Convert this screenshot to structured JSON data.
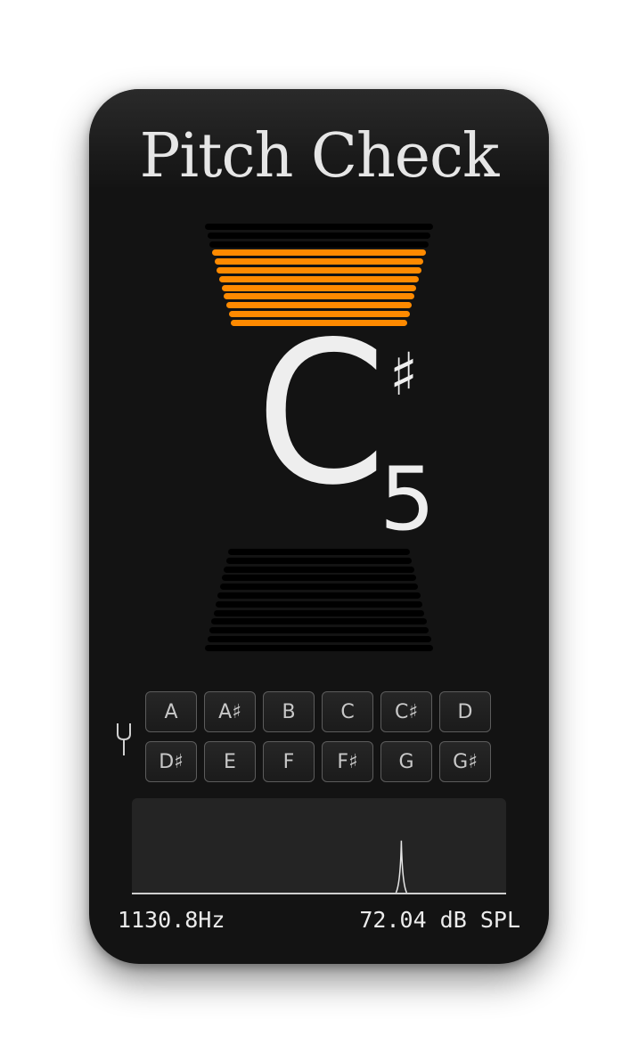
{
  "app": {
    "title": "Pitch Check"
  },
  "detected_note": {
    "letter": "C",
    "accidental": "♯",
    "octave": "5"
  },
  "tuning_meter": {
    "upper_bars_total": 12,
    "upper_bars_lit": 9,
    "lower_bars_total": 12,
    "lower_bars_lit": 0,
    "lit_color": "#ff8a00",
    "unlit_color": "#000000"
  },
  "reference_tone": {
    "icon": "tuning-fork-icon",
    "notes": [
      "A",
      "A♯",
      "B",
      "C",
      "C♯",
      "D",
      "D♯",
      "E",
      "F",
      "F♯",
      "G",
      "G♯"
    ]
  },
  "spectrum": {
    "peak_position_fraction": 0.72,
    "peak_level_fraction": 0.55
  },
  "readouts": {
    "frequency": "1130.8Hz",
    "level": "72.04 dB SPL"
  }
}
